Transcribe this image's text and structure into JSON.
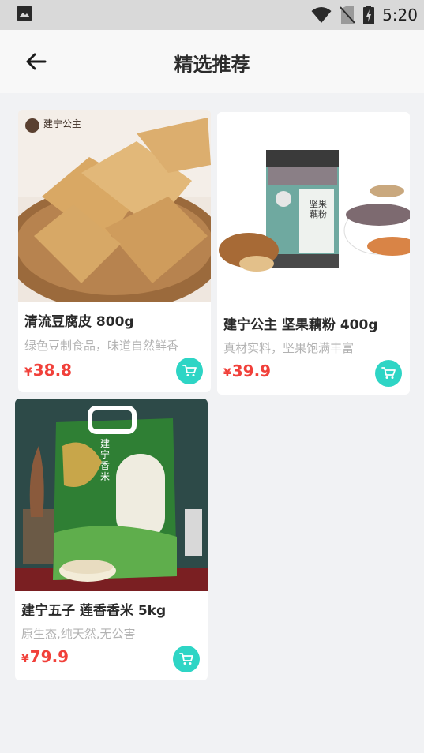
{
  "status_bar": {
    "time": "5:20"
  },
  "header": {
    "title": "精选推荐"
  },
  "products": [
    {
      "name": "清流豆腐皮 800g",
      "desc": "绿色豆制食品，味道自然鲜香",
      "currency": "¥",
      "price": "38.8",
      "photo_label": "建宁公主"
    },
    {
      "name": "建宁公主 坚果藕粉 400g",
      "desc": "真材实料，坚果饱满丰富",
      "currency": "¥",
      "price": "39.9",
      "photo_label": "坚果藕粉"
    },
    {
      "name": "建宁五子 莲香香米 5kg",
      "desc": "原生态,纯天然,无公害",
      "currency": "¥",
      "price": "79.9",
      "photo_label": "建宁香米"
    }
  ],
  "colors": {
    "accent": "#2ed5c5",
    "price": "#f1403a"
  }
}
